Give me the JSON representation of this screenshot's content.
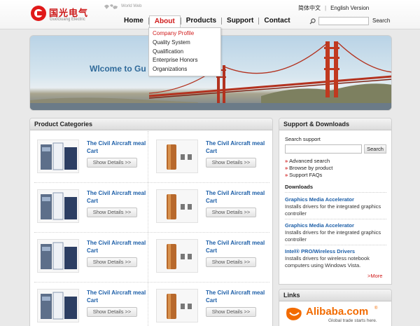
{
  "header": {
    "logo_cn": "国光电气",
    "logo_en": "GuoGuang Electric",
    "world_label": "World Web",
    "lang_cn": "简体中文",
    "lang_en": "English Version",
    "search_button": "Search"
  },
  "nav": [
    {
      "label": "Home",
      "active": false
    },
    {
      "label": "About",
      "active": true
    },
    {
      "label": "Products",
      "active": false
    },
    {
      "label": "Support",
      "active": false
    },
    {
      "label": "Contact",
      "active": false
    }
  ],
  "dropdown": [
    "Company Profile",
    "Quality System",
    "Qualification",
    "Enterprise Honors",
    "Organizations"
  ],
  "banner": {
    "title": "Wlcome to Gu"
  },
  "products": {
    "heading": "Product Categories",
    "items": [
      {
        "name": "The Civil Aircraft meal Cart",
        "button": "Show Details >>"
      },
      {
        "name": "The Civil Aircraft meal Cart",
        "button": "Show Details >>"
      },
      {
        "name": "The Civil Aircraft meal Cart",
        "button": "Show Details >>"
      },
      {
        "name": "The Civil Aircraft meal Cart",
        "button": "Show Details >>"
      },
      {
        "name": "The Civil Aircraft meal Cart",
        "button": "Show Details >>"
      },
      {
        "name": "The Civil Aircraft meal Cart",
        "button": "Show Details >>"
      },
      {
        "name": "The Civil Aircraft meal Cart",
        "button": "Show Details >>"
      },
      {
        "name": "The Civil Aircraft meal Cart",
        "button": "Show Details >>"
      }
    ]
  },
  "support": {
    "heading": "Support & Downloads",
    "search_label": "Search support",
    "search_button": "Search",
    "links": [
      "Advanced search",
      "Browse by product",
      "Support FAQs"
    ],
    "downloads_heading": "Downloads",
    "downloads": [
      {
        "title": "Graphics Media Accelerator",
        "desc": "Installs drivers for the integrated graphics controller"
      },
      {
        "title": "Graphics Media Accelerator",
        "desc": "Installs drivers for the integrated graphics controller"
      },
      {
        "title": "Intel® PRO/Wireless Drivers",
        "desc": "Installs drivers for wireless notebook computers using Windows Vista."
      }
    ],
    "more": ">More"
  },
  "links": {
    "heading": "Links",
    "alibaba_name": "Alibaba.com",
    "alibaba_tagline": "Global trade starts here.",
    "registered_mark": "®"
  },
  "colors": {
    "brand_red": "#d01a1a",
    "link_blue": "#1d5fa8",
    "alibaba_orange": "#f26b00"
  }
}
